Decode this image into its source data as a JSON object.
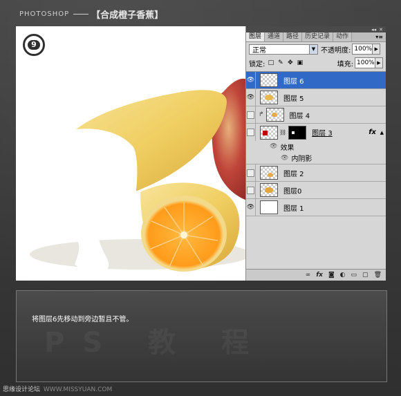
{
  "header": {
    "brand": "PHOTOSHOP",
    "title": "【合成橙子香蕉】"
  },
  "canvas": {
    "step_number": "9"
  },
  "layers_panel": {
    "tabs": [
      {
        "label": "图层",
        "active": true
      },
      {
        "label": "通道",
        "active": false
      },
      {
        "label": "路径",
        "active": false
      },
      {
        "label": "历史记录",
        "active": false
      },
      {
        "label": "动作",
        "active": false
      }
    ],
    "blend_mode": "正常",
    "opacity_label": "不透明度:",
    "opacity_value": "100%",
    "lock_label": "锁定:",
    "fill_label": "填充:",
    "fill_value": "100%",
    "layers": [
      {
        "name": "图层 6",
        "visible": true,
        "selected": true
      },
      {
        "name": "图层 5",
        "visible": true,
        "selected": false
      },
      {
        "name": "图层 4",
        "visible": false,
        "selected": false
      },
      {
        "name": "图层 3",
        "visible": false,
        "selected": false
      },
      {
        "name": "图层 2",
        "visible": false,
        "selected": false
      },
      {
        "name": "图层0",
        "visible": false,
        "selected": false
      },
      {
        "name": "图层 1",
        "visible": true,
        "selected": false
      }
    ],
    "effects_label": "效果",
    "inner_shadow_label": "内阴影",
    "fx_label": "fx"
  },
  "caption": {
    "text": "将图层6先移动到旁边暂且不管。",
    "watermark": "PS 教 程"
  },
  "footer": {
    "site_name": "思缘设计论坛",
    "site_url": "WWW.MISSYUAN.COM"
  }
}
